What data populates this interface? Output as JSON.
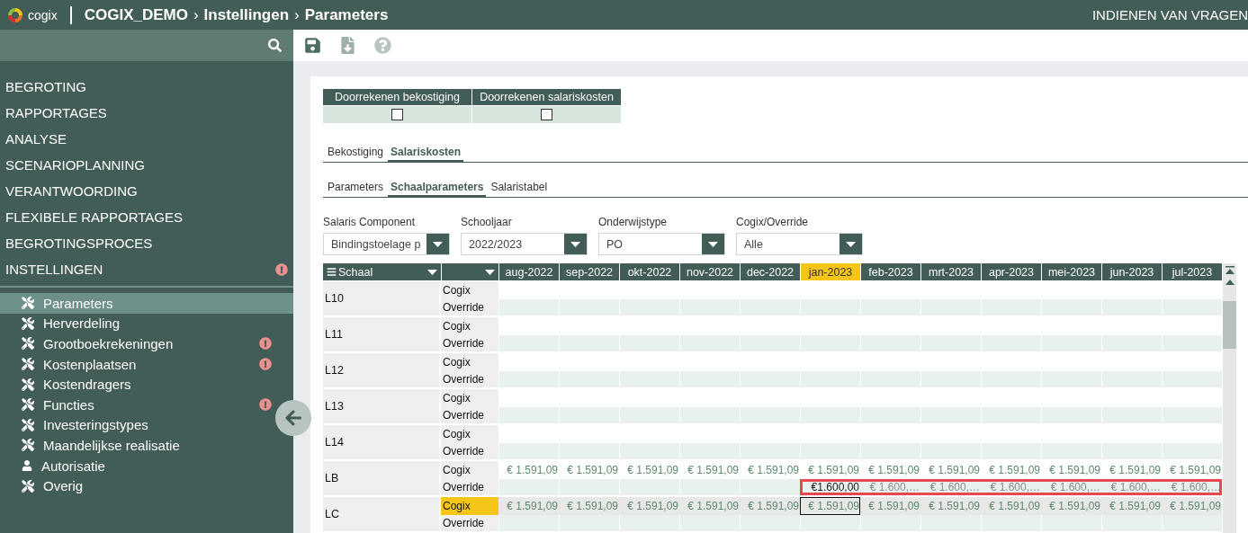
{
  "header": {
    "brand": "cogix",
    "breadcrumb": [
      "COGIX_DEMO",
      "Instellingen",
      "Parameters"
    ],
    "separators": [
      "›",
      "›"
    ],
    "right_text": "INDIENEN VAN VRAGEN"
  },
  "sidebar": {
    "menu": [
      {
        "label": "BEGROTING",
        "alert": false
      },
      {
        "label": "RAPPORTAGES",
        "alert": false
      },
      {
        "label": "ANALYSE",
        "alert": false
      },
      {
        "label": "SCENARIOPLANNING",
        "alert": false
      },
      {
        "label": "VERANTWOORDING",
        "alert": false
      },
      {
        "label": "FLEXIBELE RAPPORTAGES",
        "alert": false
      },
      {
        "label": "BEGROTINGSPROCES",
        "alert": false
      },
      {
        "label": "INSTELLINGEN",
        "alert": true
      }
    ],
    "submenu": [
      {
        "label": "Parameters",
        "kind": "tools",
        "alert": false,
        "selected": true
      },
      {
        "label": "Herverdeling",
        "kind": "tools",
        "alert": false,
        "selected": false
      },
      {
        "label": "Grootboekrekeningen",
        "kind": "tools",
        "alert": true,
        "selected": false
      },
      {
        "label": "Kostenplaatsen",
        "kind": "tools",
        "alert": true,
        "selected": false
      },
      {
        "label": "Kostendragers",
        "kind": "tools",
        "alert": false,
        "selected": false
      },
      {
        "label": "Functies",
        "kind": "tools",
        "alert": true,
        "selected": false
      },
      {
        "label": "Investeringstypes",
        "kind": "tools",
        "alert": false,
        "selected": false
      },
      {
        "label": "Maandelijkse realisatie",
        "kind": "tools",
        "alert": false,
        "selected": false
      },
      {
        "label": "Autorisatie",
        "kind": "user",
        "alert": false,
        "selected": false
      },
      {
        "label": "Overig",
        "kind": "tools",
        "alert": false,
        "selected": false
      }
    ]
  },
  "toggles": [
    {
      "label": "Doorrekenen bekostiging",
      "checked": false
    },
    {
      "label": "Doorrekenen salariskosten",
      "checked": false
    }
  ],
  "tabs": [
    {
      "label": "Bekostiging",
      "selected": false
    },
    {
      "label": "Salariskosten",
      "selected": true
    }
  ],
  "subtabs": [
    {
      "label": "Parameters",
      "selected": false
    },
    {
      "label": "Schaalparameters",
      "selected": true
    },
    {
      "label": "Salaristabel",
      "selected": false
    }
  ],
  "filters": [
    {
      "label": "Salaris Component",
      "value": "Bindingstoelage p"
    },
    {
      "label": "Schooljaar",
      "value": "2022/2023"
    },
    {
      "label": "Onderwijstype",
      "value": "PO"
    },
    {
      "label": "Cogix/Override",
      "value": "Alle"
    }
  ],
  "grid": {
    "first_column": "Schaal",
    "months": [
      {
        "label": "aug-2022",
        "selected": false
      },
      {
        "label": "sep-2022",
        "selected": false
      },
      {
        "label": "okt-2022",
        "selected": false
      },
      {
        "label": "nov-2022",
        "selected": false
      },
      {
        "label": "dec-2022",
        "selected": false
      },
      {
        "label": "jan-2023",
        "selected": true
      },
      {
        "label": "feb-2023",
        "selected": false
      },
      {
        "label": "mrt-2023",
        "selected": false
      },
      {
        "label": "apr-2023",
        "selected": false
      },
      {
        "label": "mei-2023",
        "selected": false
      },
      {
        "label": "jun-2023",
        "selected": false
      },
      {
        "label": "jul-2023",
        "selected": false
      }
    ],
    "rows": [
      {
        "name": "L10",
        "subrows": [
          {
            "label": "Cogix",
            "selected": false,
            "outlined": false,
            "cells": [
              null,
              null,
              null,
              null,
              null,
              null,
              null,
              null,
              null,
              null,
              null,
              null
            ]
          },
          {
            "label": "Override",
            "selected": false,
            "outlined": false,
            "cells": [
              null,
              null,
              null,
              null,
              null,
              null,
              null,
              null,
              null,
              null,
              null,
              null
            ]
          }
        ]
      },
      {
        "name": "L11",
        "subrows": [
          {
            "label": "Cogix",
            "selected": false,
            "outlined": false,
            "cells": [
              null,
              null,
              null,
              null,
              null,
              null,
              null,
              null,
              null,
              null,
              null,
              null
            ]
          },
          {
            "label": "Override",
            "selected": false,
            "outlined": false,
            "cells": [
              null,
              null,
              null,
              null,
              null,
              null,
              null,
              null,
              null,
              null,
              null,
              null
            ]
          }
        ]
      },
      {
        "name": "L12",
        "subrows": [
          {
            "label": "Cogix",
            "selected": false,
            "outlined": false,
            "cells": [
              null,
              null,
              null,
              null,
              null,
              null,
              null,
              null,
              null,
              null,
              null,
              null
            ]
          },
          {
            "label": "Override",
            "selected": false,
            "outlined": false,
            "cells": [
              null,
              null,
              null,
              null,
              null,
              null,
              null,
              null,
              null,
              null,
              null,
              null
            ]
          }
        ]
      },
      {
        "name": "L13",
        "subrows": [
          {
            "label": "Cogix",
            "selected": false,
            "outlined": false,
            "cells": [
              null,
              null,
              null,
              null,
              null,
              null,
              null,
              null,
              null,
              null,
              null,
              null
            ]
          },
          {
            "label": "Override",
            "selected": false,
            "outlined": false,
            "cells": [
              null,
              null,
              null,
              null,
              null,
              null,
              null,
              null,
              null,
              null,
              null,
              null
            ]
          }
        ]
      },
      {
        "name": "L14",
        "subrows": [
          {
            "label": "Cogix",
            "selected": false,
            "outlined": false,
            "cells": [
              null,
              null,
              null,
              null,
              null,
              null,
              null,
              null,
              null,
              null,
              null,
              null
            ]
          },
          {
            "label": "Override",
            "selected": false,
            "outlined": false,
            "cells": [
              null,
              null,
              null,
              null,
              null,
              null,
              null,
              null,
              null,
              null,
              null,
              null
            ]
          }
        ]
      },
      {
        "name": "LB",
        "subrows": [
          {
            "label": "Cogix",
            "selected": false,
            "outlined": false,
            "cells": [
              {
                "text": "€ 1.591,09",
                "kind": "cogix",
                "selected": false
              },
              {
                "text": "€ 1.591,09",
                "kind": "cogix",
                "selected": false
              },
              {
                "text": "€ 1.591,09",
                "kind": "cogix",
                "selected": false
              },
              {
                "text": "€ 1.591,09",
                "kind": "cogix",
                "selected": false
              },
              {
                "text": "€ 1.591,09",
                "kind": "cogix",
                "selected": false
              },
              {
                "text": "€ 1.591,09",
                "kind": "cogix",
                "selected": false
              },
              {
                "text": "€ 1.591,09",
                "kind": "cogix",
                "selected": false
              },
              {
                "text": "€ 1.591,09",
                "kind": "cogix",
                "selected": false
              },
              {
                "text": "€ 1.591,09",
                "kind": "cogix",
                "selected": false
              },
              {
                "text": "€ 1.591,09",
                "kind": "cogix",
                "selected": false
              },
              {
                "text": "€ 1.591,09",
                "kind": "cogix",
                "selected": false
              },
              {
                "text": "€ 1.591,09",
                "kind": "cogix",
                "selected": false
              }
            ]
          },
          {
            "label": "Override",
            "selected": false,
            "outlined": true,
            "cells": [
              null,
              null,
              null,
              null,
              null,
              {
                "text": "€1.600,00",
                "kind": "entered",
                "selected": false
              },
              {
                "text": "€ 1.600,…",
                "kind": "derived",
                "selected": false
              },
              {
                "text": "€ 1.600,…",
                "kind": "derived",
                "selected": false
              },
              {
                "text": "€ 1.600,…",
                "kind": "derived",
                "selected": false
              },
              {
                "text": "€ 1.600,…",
                "kind": "derived",
                "selected": false
              },
              {
                "text": "€ 1.600,…",
                "kind": "derived",
                "selected": false
              },
              {
                "text": "€ 1.600,…",
                "kind": "derived",
                "selected": false
              }
            ]
          }
        ]
      },
      {
        "name": "LC",
        "subrows": [
          {
            "label": "Cogix",
            "selected": true,
            "outlined": false,
            "cells": [
              {
                "text": "€ 1.591,09",
                "kind": "cogix",
                "selected": false
              },
              {
                "text": "€ 1.591,09",
                "kind": "cogix",
                "selected": false
              },
              {
                "text": "€ 1.591,09",
                "kind": "cogix",
                "selected": false
              },
              {
                "text": "€ 1.591,09",
                "kind": "cogix",
                "selected": false
              },
              {
                "text": "€ 1.591,09",
                "kind": "cogix",
                "selected": false
              },
              {
                "text": "€ 1.591,09",
                "kind": "cogix",
                "selected": true
              },
              {
                "text": "€ 1.591,09",
                "kind": "cogix",
                "selected": false
              },
              {
                "text": "€ 1.591,09",
                "kind": "cogix",
                "selected": false
              },
              {
                "text": "€ 1.591,09",
                "kind": "cogix",
                "selected": false
              },
              {
                "text": "€ 1.591,09",
                "kind": "cogix",
                "selected": false
              },
              {
                "text": "€ 1.591,09",
                "kind": "cogix",
                "selected": false
              },
              {
                "text": "€ 1.591,09",
                "kind": "cogix",
                "selected": false
              }
            ]
          },
          {
            "label": "Override",
            "selected": false,
            "outlined": false,
            "cells": [
              null,
              null,
              null,
              null,
              null,
              null,
              null,
              null,
              null,
              null,
              null,
              null
            ]
          }
        ]
      }
    ]
  }
}
